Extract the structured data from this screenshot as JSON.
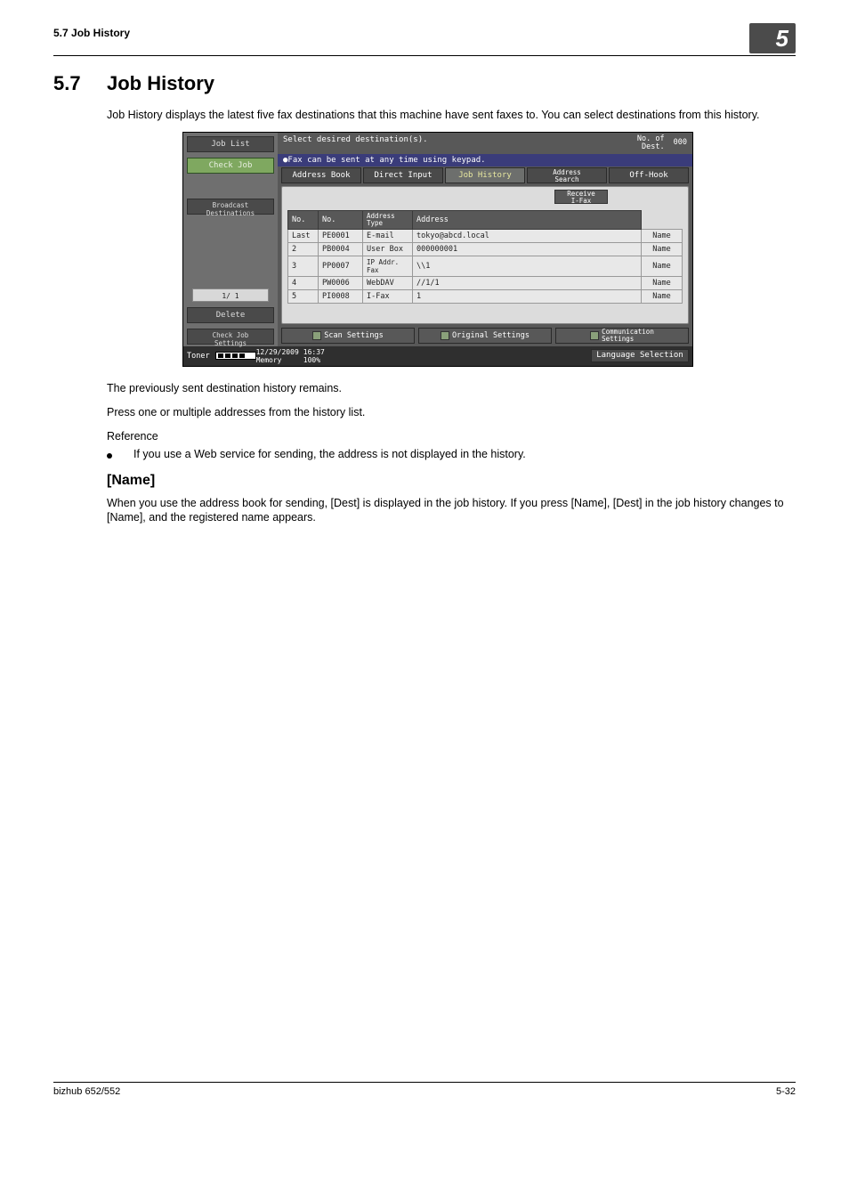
{
  "running_head": {
    "left": "5.7    Job History",
    "badge": "5"
  },
  "section": {
    "num": "5.7",
    "title": "Job History"
  },
  "intro": "Job History displays the latest five fax destinations that this machine have sent faxes to. You can select destinations from this history.",
  "after_shot_1": "The previously sent destination history remains.",
  "after_shot_2": "Press one or multiple addresses from the history list.",
  "reference_label": "Reference",
  "bullet_1": "If you use a Web service for sending, the address is not displayed in the history.",
  "name_heading": "[Name]",
  "name_body": "When you use the address book for sending, [Dest] is displayed in the job history. If you press [Name], [Dest] in the job history changes to [Name], and the registered name appears.",
  "footer": {
    "left": "bizhub 652/552",
    "right": "5-32"
  },
  "shot": {
    "left_panel": {
      "job_list": "Job List",
      "check_job": "Check Job",
      "broadcast": "Broadcast\nDestinations",
      "page": "1/   1",
      "delete": "Delete",
      "check_job_settings": "Check Job\nSettings"
    },
    "header": {
      "msg": "Select desired destination(s).",
      "count_label": "No. of\nDest.",
      "count_val": "000",
      "bluebar": "●Fax can be sent at any time using keypad."
    },
    "tabs": {
      "address_book": "Address Book",
      "direct_input": "Direct Input",
      "job_history": "Job History",
      "address_search": "Address\nSearch",
      "off_hook": "Off-Hook"
    },
    "receive": "Receive\nI-Fax",
    "thead": {
      "c1": "No.",
      "c2": "No.",
      "c3": "Address\nType",
      "c4": "Address",
      "c5": "Name"
    },
    "rows": [
      {
        "a": "Last",
        "b": "PE0001",
        "c": "E-mail",
        "d": "tokyo@abcd.local"
      },
      {
        "a": "2",
        "b": "PB0004",
        "c": "User Box",
        "d": "000000001"
      },
      {
        "a": "3",
        "b": "PP0007",
        "c": "IP Addr.\nFax",
        "d": "\\\\1"
      },
      {
        "a": "4",
        "b": "PW0006",
        "c": "WebDAV",
        "d": "//1/1"
      },
      {
        "a": "5",
        "b": "PI0008",
        "c": "I-Fax",
        "d": "1"
      }
    ],
    "bottom": {
      "scan": "Scan Settings",
      "orig": "Original Settings",
      "comm": "Communication\nSettings"
    },
    "status": {
      "toner": "Toner",
      "date": "12/29/2009",
      "mem": "Memory",
      "time": "16:37",
      "pct": "100%",
      "lang": "Language Selection"
    }
  }
}
